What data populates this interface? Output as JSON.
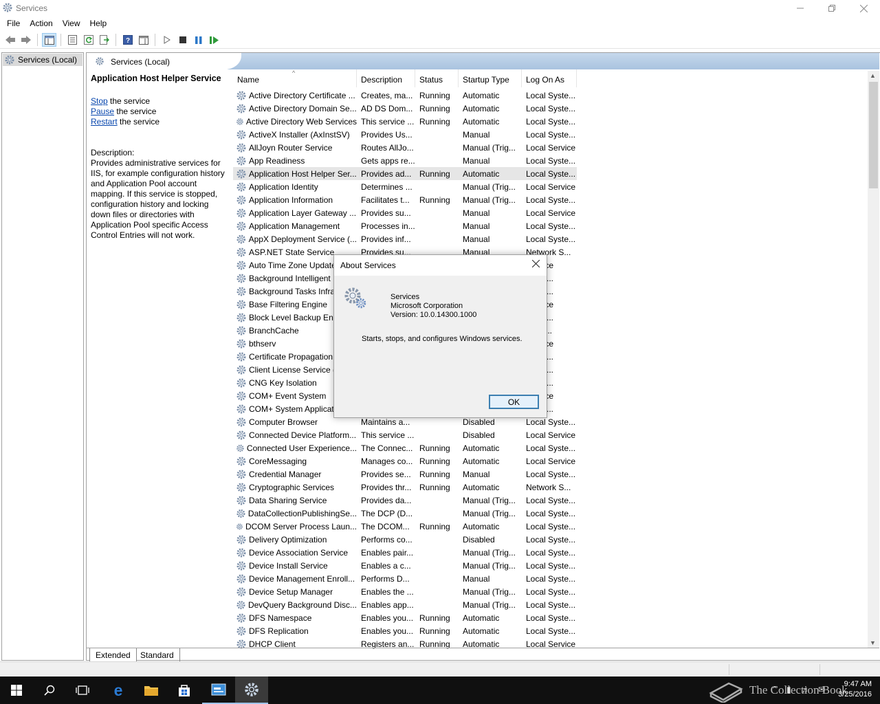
{
  "window": {
    "title": "Services"
  },
  "menu": [
    "File",
    "Action",
    "View",
    "Help"
  ],
  "tree": {
    "root_label": "Services (Local)"
  },
  "main_header": {
    "title": "Services (Local)"
  },
  "selected_service": {
    "title": "Application Host Helper Service",
    "actions": [
      {
        "link": "Stop",
        "rest": " the service"
      },
      {
        "link": "Pause",
        "rest": " the service"
      },
      {
        "link": "Restart",
        "rest": " the service"
      }
    ],
    "description_label": "Description:",
    "description": "Provides administrative services for IIS, for example configuration history and Application Pool account mapping. If this service is stopped, configuration history and locking down files or directories with Application Pool specific Access Control Entries will not work."
  },
  "columns": [
    "Name",
    "Description",
    "Status",
    "Startup Type",
    "Log On As"
  ],
  "services": [
    [
      "Active Directory Certificate ...",
      "Creates, ma...",
      "Running",
      "Automatic",
      "Local Syste..."
    ],
    [
      "Active Directory Domain Se...",
      "AD DS Dom...",
      "Running",
      "Automatic",
      "Local Syste..."
    ],
    [
      "Active Directory Web Services",
      "This service ...",
      "Running",
      "Automatic",
      "Local Syste..."
    ],
    [
      "ActiveX Installer (AxInstSV)",
      "Provides Us...",
      "",
      "Manual",
      "Local Syste..."
    ],
    [
      "AllJoyn Router Service",
      "Routes AllJo...",
      "",
      "Manual (Trig...",
      "Local Service"
    ],
    [
      "App Readiness",
      "Gets apps re...",
      "",
      "Manual",
      "Local Syste..."
    ],
    [
      "Application Host Helper Ser...",
      "Provides ad...",
      "Running",
      "Automatic",
      "Local Syste..."
    ],
    [
      "Application Identity",
      "Determines ...",
      "",
      "Manual (Trig...",
      "Local Service"
    ],
    [
      "Application Information",
      "Facilitates t...",
      "Running",
      "Manual (Trig...",
      "Local Syste..."
    ],
    [
      "Application Layer Gateway ...",
      "Provides su...",
      "",
      "Manual",
      "Local Service"
    ],
    [
      "Application Management",
      "Processes in...",
      "",
      "Manual",
      "Local Syste..."
    ],
    [
      "AppX Deployment Service (...",
      "Provides inf...",
      "",
      "Manual",
      "Local Syste..."
    ],
    [
      "ASP.NET State Service",
      "Provides su...",
      "",
      "Manual",
      "Network S..."
    ],
    [
      "Auto Time Zone Update",
      "",
      "",
      "",
      "Service"
    ],
    [
      "Background Intelligent",
      "",
      "",
      "",
      "Syste..."
    ],
    [
      "Background Tasks Infras",
      "",
      "",
      "",
      "Syste..."
    ],
    [
      "Base Filtering Engine",
      "",
      "",
      "",
      "Service"
    ],
    [
      "Block Level Backup Eng",
      "",
      "",
      "",
      "Syste..."
    ],
    [
      "BranchCache",
      "",
      "",
      "",
      "ork S..."
    ],
    [
      "bthserv",
      "",
      "",
      "",
      "Service"
    ],
    [
      "Certificate Propagation",
      "",
      "",
      "",
      "Syste..."
    ],
    [
      "Client License Service (C",
      "",
      "",
      "",
      "Syste..."
    ],
    [
      "CNG Key Isolation",
      "",
      "",
      "",
      "Syste..."
    ],
    [
      "COM+ Event System",
      "",
      "",
      "",
      "Service"
    ],
    [
      "COM+ System Applicat",
      "",
      "",
      "",
      "Syste..."
    ],
    [
      "Computer Browser",
      "Maintains a...",
      "",
      "Disabled",
      "Local Syste..."
    ],
    [
      "Connected Device Platform...",
      "This service ...",
      "",
      "Disabled",
      "Local Service"
    ],
    [
      "Connected User Experience...",
      "The Connec...",
      "Running",
      "Automatic",
      "Local Syste..."
    ],
    [
      "CoreMessaging",
      "Manages co...",
      "Running",
      "Automatic",
      "Local Service"
    ],
    [
      "Credential Manager",
      "Provides se...",
      "Running",
      "Manual",
      "Local Syste..."
    ],
    [
      "Cryptographic Services",
      "Provides thr...",
      "Running",
      "Automatic",
      "Network S..."
    ],
    [
      "Data Sharing Service",
      "Provides da...",
      "",
      "Manual (Trig...",
      "Local Syste..."
    ],
    [
      "DataCollectionPublishingSe...",
      "The DCP (D...",
      "",
      "Manual (Trig...",
      "Local Syste..."
    ],
    [
      "DCOM Server Process Laun...",
      "The DCOM...",
      "Running",
      "Automatic",
      "Local Syste..."
    ],
    [
      "Delivery Optimization",
      "Performs co...",
      "",
      "Disabled",
      "Local Syste..."
    ],
    [
      "Device Association Service",
      "Enables pair...",
      "",
      "Manual (Trig...",
      "Local Syste..."
    ],
    [
      "Device Install Service",
      "Enables a c...",
      "",
      "Manual (Trig...",
      "Local Syste..."
    ],
    [
      "Device Management Enroll...",
      "Performs D...",
      "",
      "Manual",
      "Local Syste..."
    ],
    [
      "Device Setup Manager",
      "Enables the ...",
      "",
      "Manual (Trig...",
      "Local Syste..."
    ],
    [
      "DevQuery Background Disc...",
      "Enables app...",
      "",
      "Manual (Trig...",
      "Local Syste..."
    ],
    [
      "DFS Namespace",
      "Enables you...",
      "Running",
      "Automatic",
      "Local Syste..."
    ],
    [
      "DFS Replication",
      "Enables you...",
      "Running",
      "Automatic",
      "Local Syste..."
    ],
    [
      "DHCP Client",
      "Registers an...",
      "Running",
      "Automatic",
      "Local Service"
    ]
  ],
  "selected_row": 6,
  "tabs": {
    "extended": "Extended",
    "standard": "Standard"
  },
  "dialog": {
    "title": "About Services",
    "app_name": "Services",
    "company": "Microsoft Corporation",
    "version": "Version:  10.0.14300.1000",
    "text": "Starts, stops, and configures Windows services.",
    "ok": "OK"
  },
  "taskbar": {
    "time": "9:47 AM",
    "date": "3/25/2016",
    "watermark": "The Collection Book"
  },
  "colors": {
    "accent": "#3c7fb1",
    "header_gradient": "#b4cbe3",
    "link": "#0645ad"
  }
}
